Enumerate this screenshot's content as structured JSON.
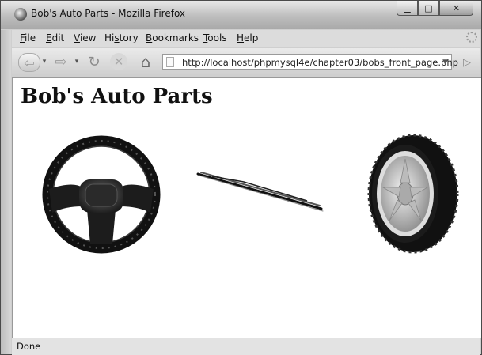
{
  "window": {
    "title": "Bob's Auto Parts - Mozilla Firefox",
    "icon": "firefox-icon"
  },
  "menu": {
    "items": [
      {
        "underline": "F",
        "rest": "ile"
      },
      {
        "underline": "E",
        "rest": "dit"
      },
      {
        "underline": "V",
        "rest": "iew"
      },
      {
        "pre": "Hi",
        "underline": "s",
        "rest": "tory"
      },
      {
        "underline": "B",
        "rest": "ookmarks"
      },
      {
        "underline": "T",
        "rest": "ools"
      },
      {
        "underline": "H",
        "rest": "elp"
      }
    ]
  },
  "navigation": {
    "url": "http://localhost/phpmysql4e/chapter03/bobs_front_page.php"
  },
  "page": {
    "heading": "Bob's Auto Parts",
    "images": [
      "steering-wheel-image",
      "wiper-blade-image",
      "tire-image"
    ]
  },
  "status": {
    "text": "Done"
  }
}
